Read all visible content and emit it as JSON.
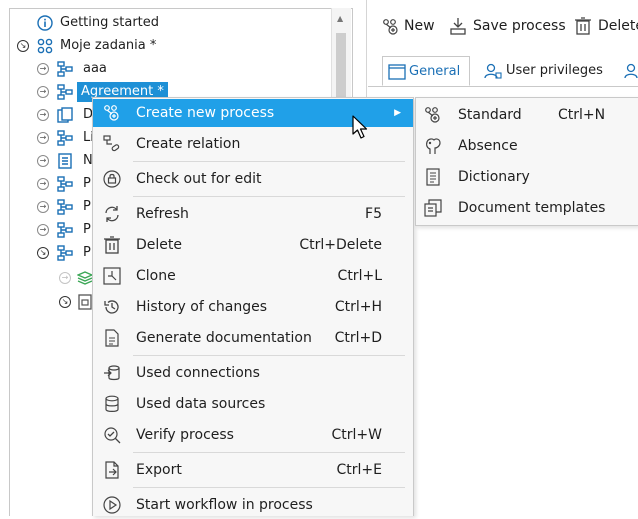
{
  "tree": {
    "items": [
      {
        "label": "Getting started"
      },
      {
        "label": "Moje zadania *"
      },
      {
        "label": "aaa"
      },
      {
        "label": "Agreement *"
      },
      {
        "label": "D"
      },
      {
        "label": "Li"
      },
      {
        "label": "N"
      },
      {
        "label": "P"
      },
      {
        "label": "P"
      },
      {
        "label": "P"
      },
      {
        "label": "P"
      }
    ]
  },
  "toolbar": {
    "new_label": "New",
    "save_label": "Save process",
    "delete_label": "Delete"
  },
  "tabs": [
    {
      "label": "General"
    },
    {
      "label": "User privileges"
    }
  ],
  "context_menu": {
    "items": [
      {
        "label": "Create new process",
        "shortcut": ""
      },
      {
        "label": "Create relation",
        "shortcut": ""
      },
      {
        "label": "Check out for edit",
        "shortcut": ""
      },
      {
        "label": "Refresh",
        "shortcut": "F5"
      },
      {
        "label": "Delete",
        "shortcut": "Ctrl+Delete"
      },
      {
        "label": "Clone",
        "shortcut": "Ctrl+L"
      },
      {
        "label": "History of changes",
        "shortcut": "Ctrl+H"
      },
      {
        "label": "Generate documentation",
        "shortcut": "Ctrl+D"
      },
      {
        "label": "Used connections",
        "shortcut": ""
      },
      {
        "label": "Used data sources",
        "shortcut": ""
      },
      {
        "label": "Verify process",
        "shortcut": "Ctrl+W"
      },
      {
        "label": "Export",
        "shortcut": "Ctrl+E"
      },
      {
        "label": "Start workflow in process",
        "shortcut": ""
      }
    ]
  },
  "submenu": {
    "items": [
      {
        "label": "Standard",
        "shortcut": "Ctrl+N"
      },
      {
        "label": "Absence",
        "shortcut": ""
      },
      {
        "label": "Dictionary",
        "shortcut": ""
      },
      {
        "label": "Document templates",
        "shortcut": ""
      }
    ]
  },
  "colors": {
    "accent": "#20a0e8",
    "selection": "#1e90d6",
    "icon_blue": "#1a6fb5",
    "menu_bg": "#f7f7f7"
  }
}
